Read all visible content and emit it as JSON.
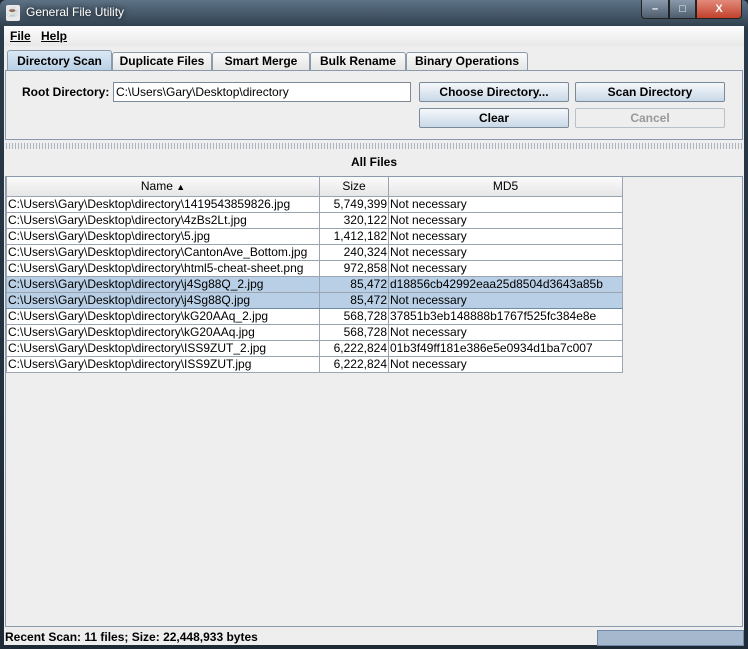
{
  "window": {
    "title": "General File Utility",
    "icon": "java-icon"
  },
  "menu": [
    {
      "label": "File",
      "mnemonic": "F"
    },
    {
      "label": "Help",
      "mnemonic": "H"
    }
  ],
  "tabs": [
    "Directory Scan",
    "Duplicate Files",
    "Smart Merge",
    "Bulk Rename",
    "Binary Operations"
  ],
  "active_tab": "Directory Scan",
  "scan": {
    "root_label": "Root Directory:",
    "root_value": "C:\\Users\\Gary\\Desktop\\directory",
    "choose_button": "Choose Directory...",
    "scan_button": "Scan Directory",
    "clear_button": "Clear",
    "cancel_button": "Cancel"
  },
  "table": {
    "title": "All Files",
    "columns": [
      "Name",
      "Size",
      "MD5"
    ],
    "sort_indicator": "▲",
    "rows": [
      {
        "name": "C:\\Users\\Gary\\Desktop\\directory\\1419543859826.jpg",
        "size": "5,749,399",
        "md5": "Not necessary"
      },
      {
        "name": "C:\\Users\\Gary\\Desktop\\directory\\4zBs2Lt.jpg",
        "size": "320,122",
        "md5": "Not necessary"
      },
      {
        "name": "C:\\Users\\Gary\\Desktop\\directory\\5.jpg",
        "size": "1,412,182",
        "md5": "Not necessary"
      },
      {
        "name": "C:\\Users\\Gary\\Desktop\\directory\\CantonAve_Bottom.jpg",
        "size": "240,324",
        "md5": "Not necessary"
      },
      {
        "name": "C:\\Users\\Gary\\Desktop\\directory\\html5-cheat-sheet.png",
        "size": "972,858",
        "md5": "Not necessary"
      },
      {
        "name": "C:\\Users\\Gary\\Desktop\\directory\\j4Sg88Q_2.jpg",
        "size": "85,472",
        "md5": "d18856cb42992eaa25d8504d3643a85b",
        "selected": true
      },
      {
        "name": "C:\\Users\\Gary\\Desktop\\directory\\j4Sg88Q.jpg",
        "size": "85,472",
        "md5": "Not necessary",
        "selected": true,
        "focused": true
      },
      {
        "name": "C:\\Users\\Gary\\Desktop\\directory\\kG20AAq_2.jpg",
        "size": "568,728",
        "md5": "37851b3eb148888b1767f525fc384e8e"
      },
      {
        "name": "C:\\Users\\Gary\\Desktop\\directory\\kG20AAq.jpg",
        "size": "568,728",
        "md5": "Not necessary"
      },
      {
        "name": "C:\\Users\\Gary\\Desktop\\directory\\ISS9ZUT_2.jpg",
        "size": "6,222,824",
        "md5": "01b3f49ff181e386e5e0934d1ba7c007"
      },
      {
        "name": "C:\\Users\\Gary\\Desktop\\directory\\ISS9ZUT.jpg",
        "size": "6,222,824",
        "md5": "Not necessary"
      }
    ]
  },
  "status": {
    "text": "Recent Scan: 11 files; Size: 22,448,933 bytes"
  },
  "colors": {
    "selection": "#b8cfe5",
    "accent": "#8b9aaa"
  }
}
